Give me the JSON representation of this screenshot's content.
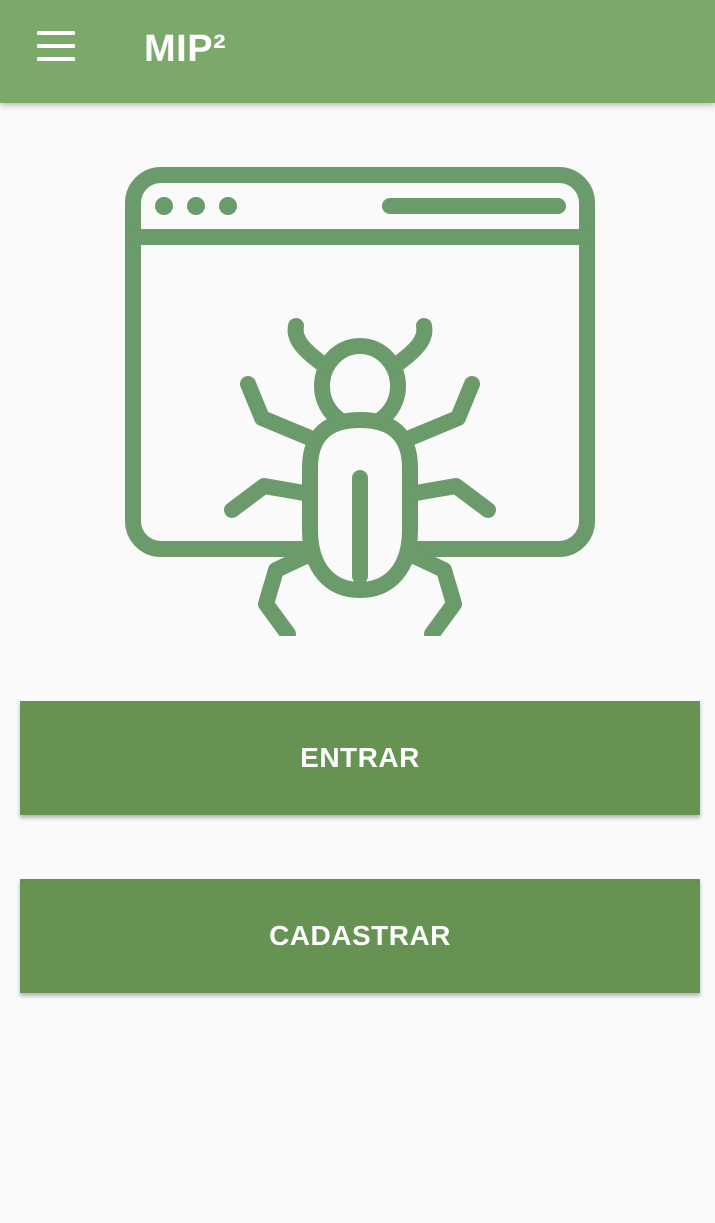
{
  "app_bar": {
    "title": "MIP²",
    "menu_icon": "hamburger-menu-icon",
    "background_color": "#7ba96a"
  },
  "illustration": {
    "icon": "browser-bug-icon",
    "color": "#6b9b6b"
  },
  "actions": {
    "login_label": "ENTRAR",
    "signup_label": "CADASTRAR",
    "button_color": "#669352"
  }
}
